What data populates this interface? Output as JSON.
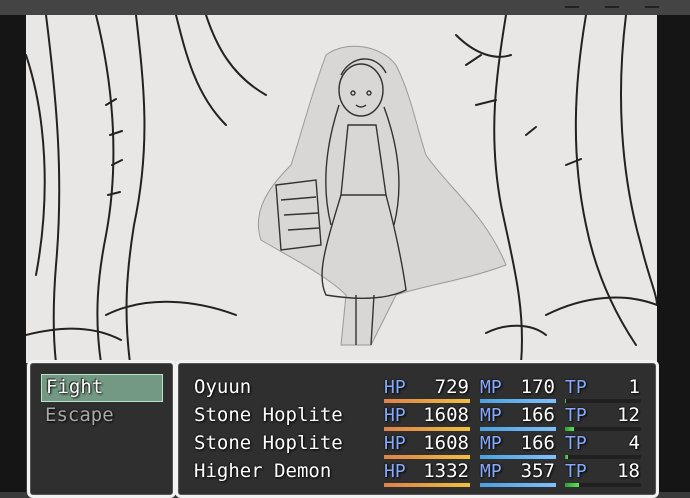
{
  "commands": [
    {
      "label": "Fight",
      "selected": true,
      "enabled": true
    },
    {
      "label": "Escape",
      "selected": false,
      "enabled": false
    }
  ],
  "labels": {
    "hp": "HP",
    "mp": "MP",
    "tp": "TP"
  },
  "party": [
    {
      "name": "Oyuun",
      "hp": "729",
      "mp": "170",
      "tp": "1",
      "hp_fraction": 1.0,
      "mp_fraction": 1.0,
      "tp_fraction": 0.01
    },
    {
      "name": "Stone Hoplite",
      "hp": "1608",
      "mp": "166",
      "tp": "12",
      "hp_fraction": 1.0,
      "mp_fraction": 1.0,
      "tp_fraction": 0.12
    },
    {
      "name": "Stone Hoplite",
      "hp": "1608",
      "mp": "166",
      "tp": "4",
      "hp_fraction": 1.0,
      "mp_fraction": 1.0,
      "tp_fraction": 0.04
    },
    {
      "name": "Higher Demon",
      "hp": "1332",
      "mp": "357",
      "tp": "18",
      "hp_fraction": 1.0,
      "mp_fraction": 1.0,
      "tp_fraction": 0.18
    }
  ],
  "colors": {
    "stat_label": "#84aaff",
    "window_border": "#f2f2f2",
    "selected_highlight": "#8cbea0"
  }
}
